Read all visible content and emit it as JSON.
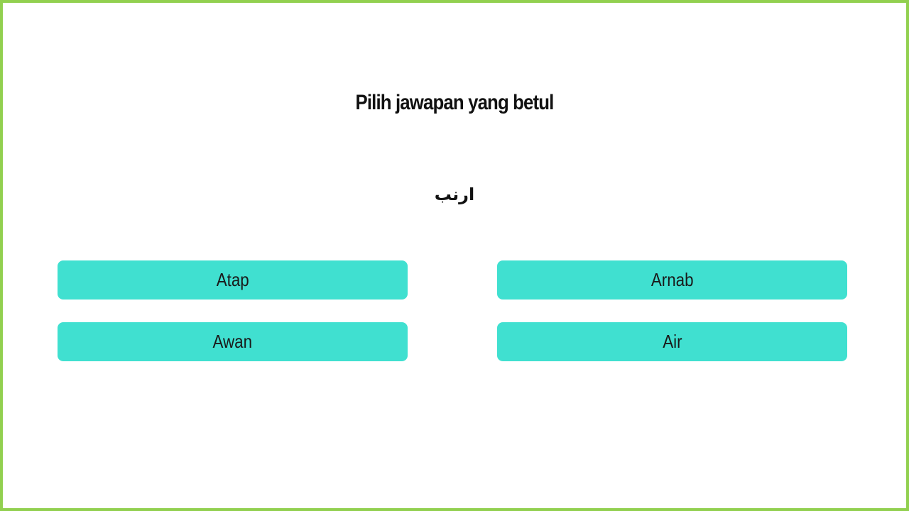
{
  "quiz": {
    "instruction": "Pilih jawapan yang betul",
    "question_word": "ارنب",
    "options": [
      {
        "label": "Atap"
      },
      {
        "label": "Arnab"
      },
      {
        "label": "Awan"
      },
      {
        "label": "Air"
      }
    ]
  },
  "colors": {
    "frame_border": "#92d050",
    "button_fill": "#40e0d0",
    "background": "#ffffff"
  }
}
